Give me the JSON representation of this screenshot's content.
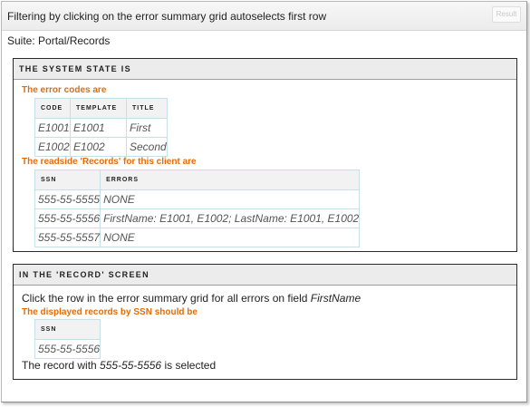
{
  "header": {
    "title": "Filtering by clicking on the error summary grid autoselects first row",
    "result_button": "Result"
  },
  "suite": "Suite: Portal/Records",
  "system_state": {
    "heading": "THE SYSTEM STATE IS",
    "error_codes_label": "The error codes are",
    "error_codes_table": {
      "columns": [
        "CODE",
        "TEMPLATE",
        "TITLE"
      ],
      "rows": [
        [
          "E1001",
          "E1001",
          "First"
        ],
        [
          "E1002",
          "E1002",
          "Second"
        ]
      ]
    },
    "records_label": "The readside 'Records' for this client are",
    "records_table": {
      "columns": [
        "SSN",
        "ERRORS"
      ],
      "rows": [
        [
          "555-55-5555",
          "NONE"
        ],
        [
          "555-55-5556",
          "FirstName: E1001, E1002; LastName: E1001, E1002"
        ],
        [
          "555-55-5557",
          "NONE"
        ]
      ]
    }
  },
  "record_screen": {
    "heading": "IN THE 'RECORD' SCREEN",
    "instruction_prefix": "Click the row in the error summary grid for all errors on field ",
    "instruction_field": "FirstName",
    "displayed_label": "The displayed records by SSN should be",
    "ssn_table": {
      "columns": [
        "SSN"
      ],
      "rows": [
        [
          "555-55-5556"
        ]
      ]
    },
    "selected_prefix": "The record with ",
    "selected_ssn": "555-55-5556",
    "selected_suffix": " is selected"
  }
}
